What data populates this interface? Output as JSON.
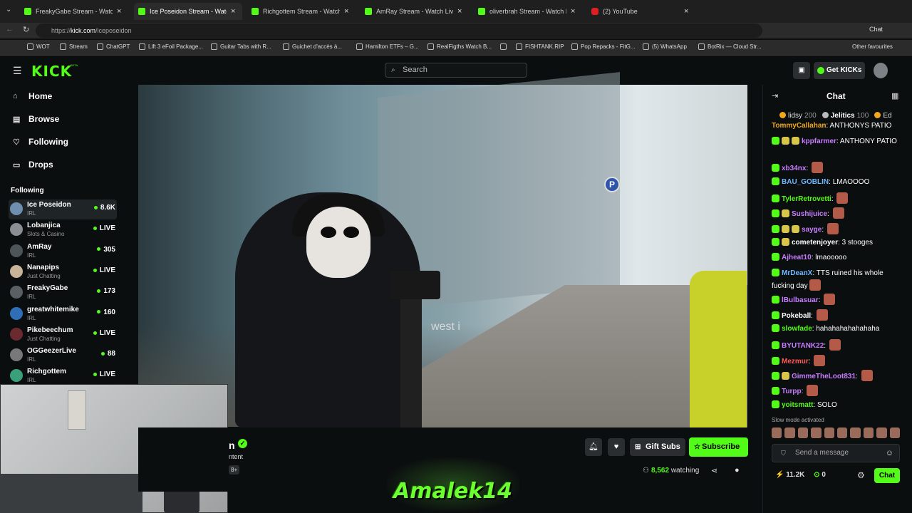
{
  "browser": {
    "tabs": [
      {
        "title": "FreakyGabe Stream - Watch L",
        "favicon": "kick-icon"
      },
      {
        "title": "Ice Poseidon Stream - Watch",
        "favicon": "kick-icon",
        "active": true
      },
      {
        "title": "Richgottem Stream - Watch L",
        "favicon": "kick-icon"
      },
      {
        "title": "AmRay Stream - Watch Live o",
        "favicon": "kick-icon"
      },
      {
        "title": "oliverbrah Stream - Watch Live on",
        "favicon": "kick-icon"
      },
      {
        "title": "(2) YouTube",
        "favicon": "youtube-icon"
      }
    ],
    "url_prefix": "https://",
    "url_domain": "kick.com",
    "url_path": "/iceposeidon",
    "chat_label": "Chat",
    "bookmarks": [
      "WOT",
      "Stream",
      "ChatGPT",
      "Lift 3 eFoil Package...",
      "Guitar Tabs with R...",
      "Guichet d'accès à...",
      "Hamilton ETFs – G...",
      "RealFigths Watch B...",
      "",
      "FISHTANK.RIP",
      "Pop Repacks - FitG...",
      "(5) WhatsApp",
      "BotRix — Cloud Str..."
    ],
    "other_favourites": "Other favourites"
  },
  "kick": {
    "logo": "KICK",
    "logo_beta": "BETA",
    "search_placeholder": "Search",
    "get_kicks": "Get KICKs"
  },
  "sidebar": {
    "nav": [
      {
        "label": "Home",
        "icon": "home-icon"
      },
      {
        "label": "Browse",
        "icon": "browse-icon"
      },
      {
        "label": "Following",
        "icon": "heart-icon"
      },
      {
        "label": "Drops",
        "icon": "drops-icon"
      }
    ],
    "following_header": "Following",
    "following": [
      {
        "name": "Ice Poseidon",
        "category": "IRL",
        "status": "8.6K"
      },
      {
        "name": "Lobanjica",
        "category": "Slots & Casino",
        "status": "LIVE"
      },
      {
        "name": "AmRay",
        "category": "IRL",
        "status": "305"
      },
      {
        "name": "Nanapips",
        "category": "Just Chatting",
        "status": "LIVE"
      },
      {
        "name": "FreakyGabe",
        "category": "IRL",
        "status": "173"
      },
      {
        "name": "greatwhitemike",
        "category": "IRL",
        "status": "160"
      },
      {
        "name": "Pikebeechum",
        "category": "Just Chatting",
        "status": "LIVE"
      },
      {
        "name": "OGGeezerLive",
        "category": "IRL",
        "status": "88"
      },
      {
        "name": "Richgottem",
        "category": "IRL",
        "status": "LIVE"
      }
    ]
  },
  "stream": {
    "name_partial": "n",
    "category_partial": "ntent",
    "age_badge": "8+",
    "gift_subs": "Gift Subs",
    "subscribe": "Subscribe",
    "watching_count": "8,562",
    "watching_label": "watching",
    "video_sign_text": "west i",
    "overlay_text": "Amalek14"
  },
  "chat": {
    "title": "Chat",
    "pinned": [
      {
        "name": "lidsy",
        "amount": "200"
      },
      {
        "name": "Jelitics",
        "amount": "100"
      },
      {
        "name": "Ed",
        "amount": ""
      }
    ],
    "messages": [
      {
        "user": "TommyCallahan",
        "color": "#f2a81d",
        "text": "ANTHONYS PATIO",
        "badges": 0,
        "emote": false
      },
      {
        "user": "kppfarmer",
        "color": "#c77dff",
        "text": "ANTHONY PATIO",
        "badges": 3,
        "emote": false
      },
      {
        "user": "xb34nx",
        "color": "#c77dff",
        "text": "",
        "badges": 1,
        "emote": true
      },
      {
        "user": "BAU_GOBLIN",
        "color": "#6fb8ff",
        "text": "LMAOOOO",
        "badges": 1,
        "emote": false
      },
      {
        "user": "TylerRetrovetti",
        "color": "#53fc18",
        "text": "",
        "badges": 1,
        "emote": true
      },
      {
        "user": "Sushijuice",
        "color": "#c77dff",
        "text": "",
        "badges": 2,
        "emote": true
      },
      {
        "user": "sayge",
        "color": "#c77dff",
        "text": "",
        "badges": 3,
        "emote": true
      },
      {
        "user": "cometenjoyer",
        "color": "#ffffff",
        "text": "3 stooges",
        "badges": 2,
        "emote": false
      },
      {
        "user": "Ajheat10",
        "color": "#c77dff",
        "text": "lmaooooo",
        "badges": 1,
        "emote": false
      },
      {
        "user": "MrDeanX",
        "color": "#6fb8ff",
        "text": "TTS ruined his whole",
        "badges": 1,
        "emote": false
      },
      {
        "user": "",
        "color": "#ffffff",
        "text": "fucking day",
        "badges": 0,
        "emote": true
      },
      {
        "user": "lBulbasuar",
        "color": "#c77dff",
        "text": "",
        "badges": 1,
        "emote": true
      },
      {
        "user": "Pokeball",
        "color": "#ffffff",
        "text": "",
        "badges": 1,
        "emote": true
      },
      {
        "user": "slowfade",
        "color": "#53fc18",
        "text": "hahahahahahahaha",
        "badges": 1,
        "emote": false
      },
      {
        "user": "BYUTANK22",
        "color": "#c77dff",
        "text": "",
        "badges": 1,
        "emote": true
      },
      {
        "user": "Mezmur",
        "color": "#ff5a5a",
        "text": "",
        "badges": 1,
        "emote": true
      },
      {
        "user": "GimmeTheLoot831",
        "color": "#c77dff",
        "text": "",
        "badges": 2,
        "emote": true
      },
      {
        "user": "Turpp",
        "color": "#c77dff",
        "text": "",
        "badges": 1,
        "emote": true
      },
      {
        "user": "yoitsmatt",
        "color": "#53fc18",
        "text": "SOLO",
        "badges": 1,
        "emote": false
      }
    ],
    "slow_mode": "Slow mode activated",
    "send_placeholder": "Send a message",
    "kicks_count": "11.2K",
    "points_count": "0",
    "send_button": "Chat"
  },
  "colors": {
    "accent": "#53fc18",
    "background": "#0b0e0f",
    "panel": "#2a2e30"
  }
}
